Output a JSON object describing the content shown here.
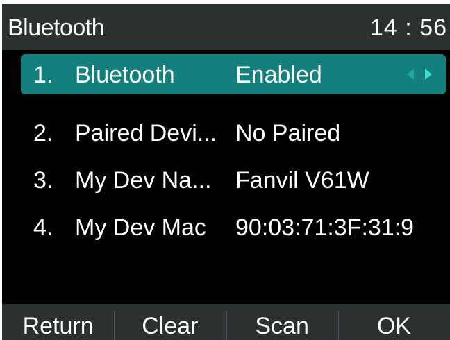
{
  "header": {
    "title": "Bluetooth",
    "time": "14 : 56"
  },
  "menu": {
    "items": [
      {
        "num": "1.",
        "label": "Bluetooth",
        "value": "Enabled",
        "selected": true
      },
      {
        "num": "2.",
        "label": "Paired Devi...",
        "value": "No Paired",
        "selected": false
      },
      {
        "num": "3.",
        "label": "My Dev Na...",
        "value": "Fanvil V61W",
        "selected": false
      },
      {
        "num": "4.",
        "label": "My Dev Mac",
        "value": "90:03:71:3F:31:9",
        "selected": false
      }
    ]
  },
  "softkeys": {
    "return": "Return",
    "clear": "Clear",
    "scan": "Scan",
    "ok": "OK"
  },
  "colors": {
    "selection": "#13807e",
    "header_bg": "#2b3031",
    "screen_bg": "#000000",
    "arrow_dim": "#1fa69f",
    "arrow_bright": "#35e0d2"
  },
  "icons": {
    "selector": "left-right-arrows-icon"
  }
}
